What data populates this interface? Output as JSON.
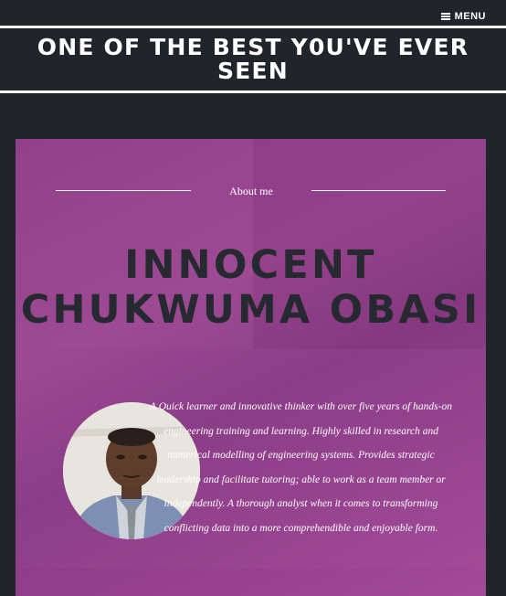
{
  "nav": {
    "menu_label": "MENU",
    "menu_icon": "hamburger-icon"
  },
  "site": {
    "title": "ONE OF THE BEST Y0U'VE EVER SEEN"
  },
  "about": {
    "label": "About me",
    "name": "INNOCENT CHUKWUMA OBASI",
    "bio": "A Quick learner and innovative thinker with over five years of hands-on engineering training and learning. Highly skilled in research and numerical modelling of engineering systems. Provides strategic leadership and facilitate tutoring; able to work as a team member or independently. A thorough analyst when it comes to transforming conflicting data into a more comprehendible and enjoyable form."
  },
  "colors": {
    "background": "#1f252b",
    "panel": "#9a4591",
    "name_text": "#262930",
    "white": "#ffffff"
  }
}
